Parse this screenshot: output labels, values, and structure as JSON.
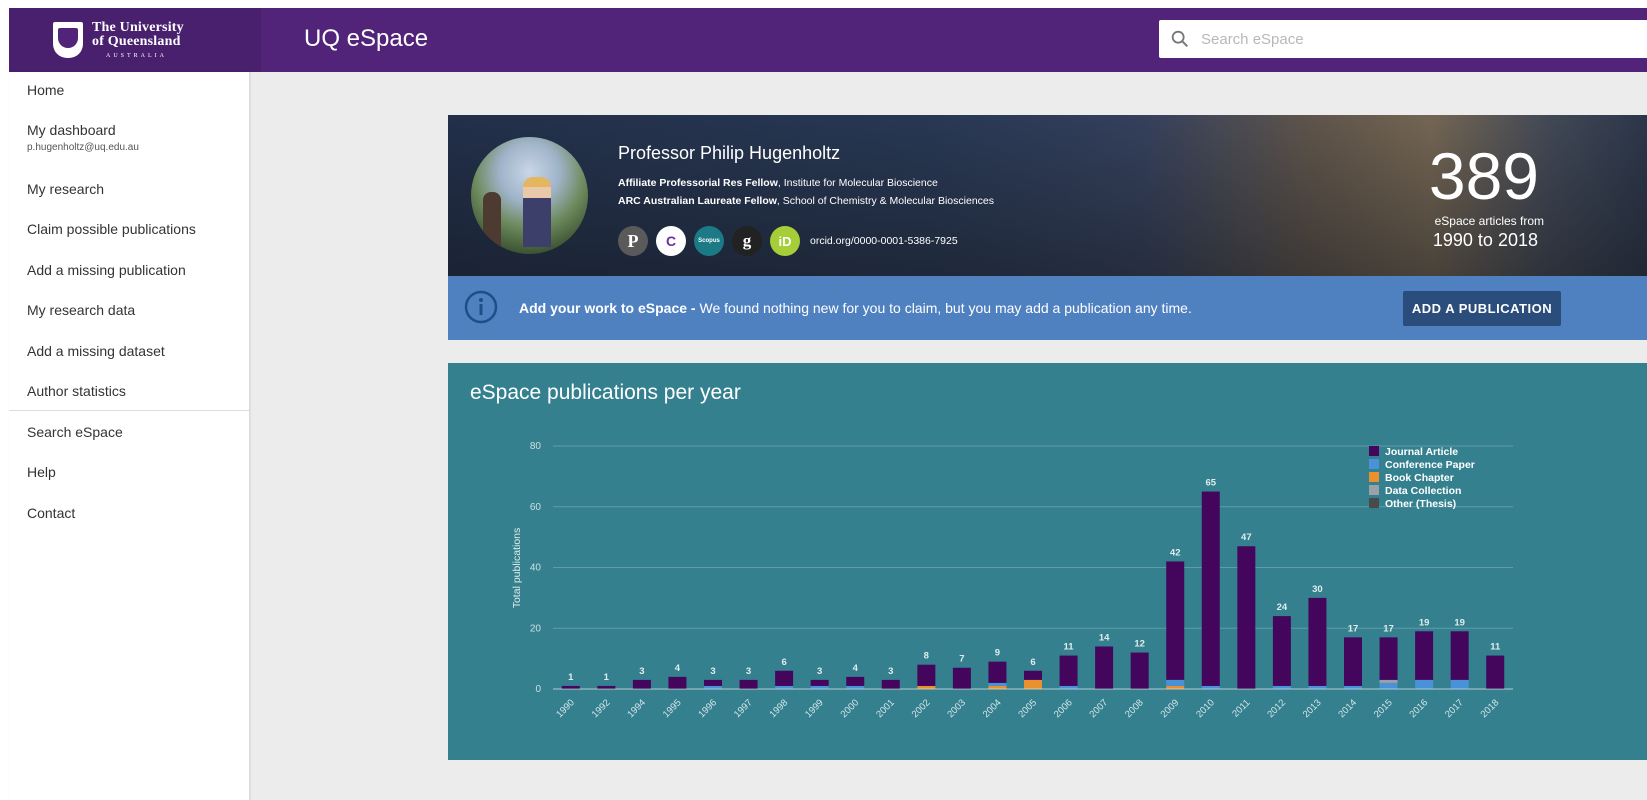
{
  "header": {
    "logo": {
      "line1": "The University",
      "line2": "of Queensland",
      "line3": "AUSTRALIA"
    },
    "app_title": "UQ eSpace",
    "search": {
      "placeholder": "Search eSpace",
      "icon": "search-icon"
    }
  },
  "sidebar": {
    "items": [
      {
        "label": "Home"
      },
      {
        "label": "My dashboard",
        "sub": "p.hugenholtz@uq.edu.au"
      },
      {
        "label": "My research"
      },
      {
        "label": "Claim possible publications"
      },
      {
        "label": "Add a missing publication"
      },
      {
        "label": "My research data"
      },
      {
        "label": "Add a missing dataset"
      },
      {
        "label": "Author statistics"
      },
      {
        "label": "Search eSpace"
      },
      {
        "label": "Help"
      },
      {
        "label": "Contact"
      }
    ]
  },
  "profile": {
    "name": "Professor Philip Hugenholtz",
    "roles": [
      {
        "title": "Affiliate Professorial Res Fellow",
        "org": ", Institute for Molecular Bioscience"
      },
      {
        "title": "ARC Australian Laureate Fellow",
        "org": ", School of Chemistry & Molecular Biosciences"
      }
    ],
    "badges": [
      {
        "icon": "publons-icon",
        "glyph": "P",
        "color": "#5a5a5a"
      },
      {
        "icon": "researcherid-icon",
        "glyph": "C",
        "color": "#ffffff"
      },
      {
        "icon": "scopus-icon",
        "glyph": "Scopus",
        "color": "#1b7a85"
      },
      {
        "icon": "google-scholar-icon",
        "glyph": "g",
        "color": "#222222"
      },
      {
        "icon": "orcid-icon",
        "glyph": "iD",
        "color": "#a6ce39"
      }
    ],
    "orcid": "orcid.org/0000-0001-5386-7925",
    "stats": {
      "count": "389",
      "label": "eSpace articles from",
      "range": "1990 to 2018"
    }
  },
  "alert": {
    "bold": "Add your work to eSpace - ",
    "text": "We found nothing new for you to claim, but you may add a publication any time.",
    "button": "ADD A PUBLICATION"
  },
  "chart_title": "eSpace publications per year",
  "chart_data": {
    "type": "bar",
    "stacked": true,
    "categories": [
      "1990",
      "1992",
      "1994",
      "1995",
      "1996",
      "1997",
      "1998",
      "1999",
      "2000",
      "2001",
      "2002",
      "2003",
      "2004",
      "2005",
      "2006",
      "2007",
      "2008",
      "2009",
      "2010",
      "2011",
      "2012",
      "2013",
      "2014",
      "2015",
      "2016",
      "2017",
      "2018"
    ],
    "totals": [
      1,
      1,
      3,
      4,
      3,
      3,
      6,
      3,
      4,
      3,
      8,
      7,
      9,
      6,
      11,
      14,
      12,
      42,
      65,
      47,
      24,
      30,
      17,
      17,
      19,
      19,
      11
    ],
    "series": [
      {
        "name": "Journal Article",
        "color": "#44065c",
        "values": [
          1,
          1,
          3,
          4,
          2,
          3,
          5,
          2,
          3,
          3,
          7,
          7,
          7,
          3,
          10,
          14,
          12,
          39,
          64,
          47,
          23,
          29,
          16,
          14,
          16,
          16,
          11
        ]
      },
      {
        "name": "Conference Paper",
        "color": "#4a92d8",
        "values": [
          0,
          0,
          0,
          0,
          1,
          0,
          1,
          1,
          1,
          0,
          0,
          0,
          1,
          0,
          1,
          0,
          0,
          2,
          1,
          0,
          1,
          1,
          1,
          2,
          3,
          3,
          0
        ]
      },
      {
        "name": "Book Chapter",
        "color": "#e8912e",
        "values": [
          0,
          0,
          0,
          0,
          0,
          0,
          0,
          0,
          0,
          0,
          1,
          0,
          1,
          3,
          0,
          0,
          0,
          1,
          0,
          0,
          0,
          0,
          0,
          0,
          0,
          0,
          0
        ]
      },
      {
        "name": "Data Collection",
        "color": "#9aa0a8",
        "values": [
          0,
          0,
          0,
          0,
          0,
          0,
          0,
          0,
          0,
          0,
          0,
          0,
          0,
          0,
          0,
          0,
          0,
          0,
          0,
          0,
          0,
          0,
          0,
          1,
          0,
          0,
          0
        ]
      },
      {
        "name": "Other (Thesis)",
        "color": "#4a4a4a",
        "values": [
          0,
          0,
          0,
          0,
          0,
          0,
          0,
          0,
          0,
          0,
          0,
          0,
          0,
          0,
          0,
          0,
          0,
          0,
          0,
          0,
          0,
          0,
          0,
          0,
          0,
          0,
          0
        ]
      }
    ],
    "ylabel": "Total publications",
    "ylim": [
      0,
      80
    ],
    "yticks": [
      0,
      20,
      40,
      60,
      80
    ],
    "legend": "top-right",
    "grid": true
  }
}
